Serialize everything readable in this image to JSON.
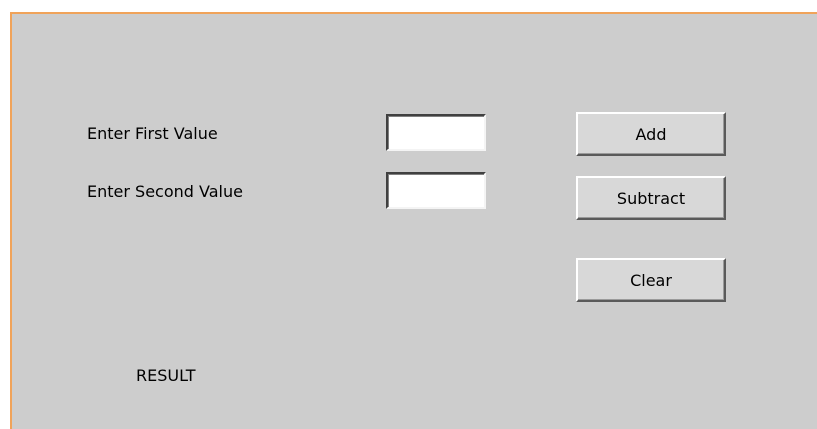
{
  "form": {
    "first_label": "Enter First Value",
    "second_label": "Enter Second Value",
    "first_value": "",
    "second_value": "",
    "result_label": "RESULT"
  },
  "buttons": {
    "add": "Add",
    "subtract": "Subtract",
    "clear": "Clear"
  },
  "colors": {
    "background": "#cdcdcd",
    "frame_border": "#f0a35a"
  }
}
